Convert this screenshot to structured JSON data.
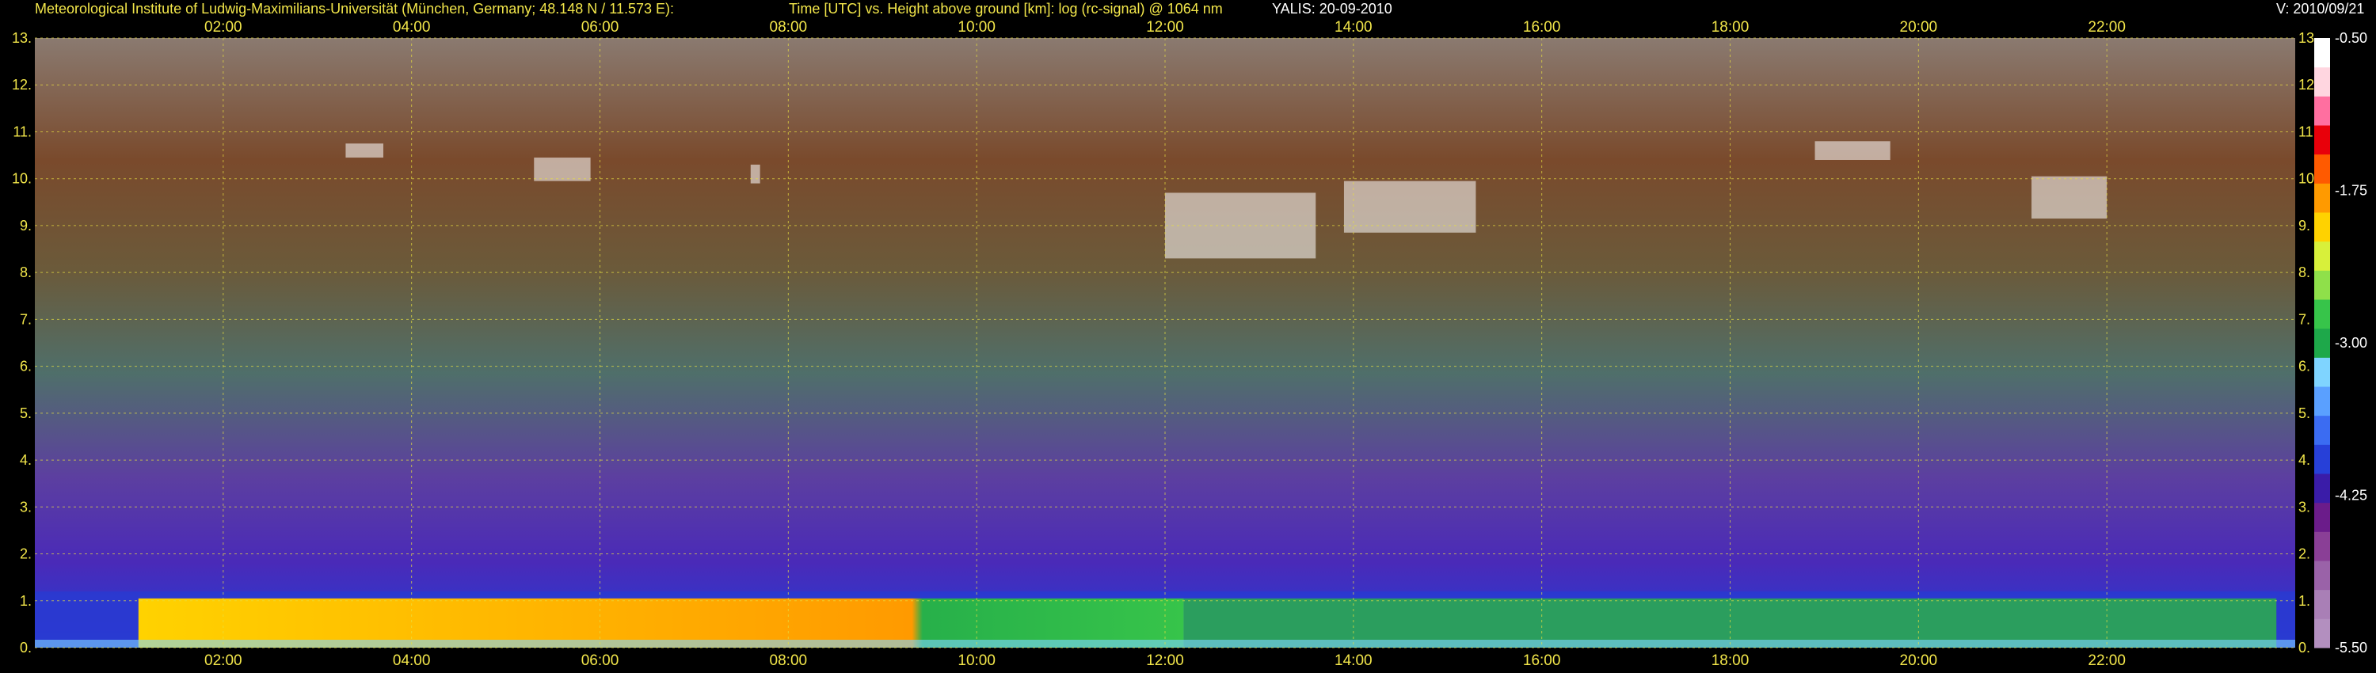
{
  "header": {
    "institute": "Meteorological Institute of Ludwig-Maximilians-Universität (München, Germany; 48.148 N / 11.573 E):",
    "axes_desc": "Time [UTC] vs. Height above ground [km]: log (rc-signal) @ 1064 nm",
    "station": "YALIS: 20-09-2010",
    "version": "V: 2010/09/21"
  },
  "chart_data": {
    "type": "heatmap",
    "title": "Time [UTC] vs. Height above ground [km]: log (rc-signal) @ 1064 nm",
    "x_tick_labels": [
      "02:00",
      "04:00",
      "06:00",
      "08:00",
      "10:00",
      "12:00",
      "14:00",
      "16:00",
      "18:00",
      "20:00",
      "22:00"
    ],
    "x_ticks_hours": [
      2,
      4,
      6,
      8,
      10,
      12,
      14,
      16,
      18,
      20,
      22
    ],
    "xlim_hours": [
      0,
      24
    ],
    "y_tick_labels": [
      "0.",
      "1.",
      "2.",
      "3.",
      "4.",
      "5.",
      "6.",
      "7.",
      "8.",
      "9.",
      "10.",
      "11.",
      "12.",
      "13."
    ],
    "y_ticks_km": [
      0,
      1,
      2,
      3,
      4,
      5,
      6,
      7,
      8,
      9,
      10,
      11,
      12,
      13
    ],
    "ylim_km": [
      0,
      13
    ],
    "grid": true,
    "colorbar": {
      "tick_labels": [
        "-0.50",
        "-1.75",
        "-3.00",
        "-4.25",
        "-5.50"
      ],
      "range": [
        -5.5,
        -0.5
      ],
      "colors": [
        "#b38fbf",
        "#a97fb6",
        "#9a62a8",
        "#8a3f96",
        "#6b1c8a",
        "#3a1ca8",
        "#2740d8",
        "#3b6cf2",
        "#5aa0ff",
        "#7fd4ff",
        "#1ea84a",
        "#37c44a",
        "#8fe04a",
        "#d8f03a",
        "#ffd200",
        "#ff9a00",
        "#ff5a00",
        "#e8000a",
        "#ff6fa0",
        "#ffd6e0",
        "#ffffff"
      ]
    }
  }
}
